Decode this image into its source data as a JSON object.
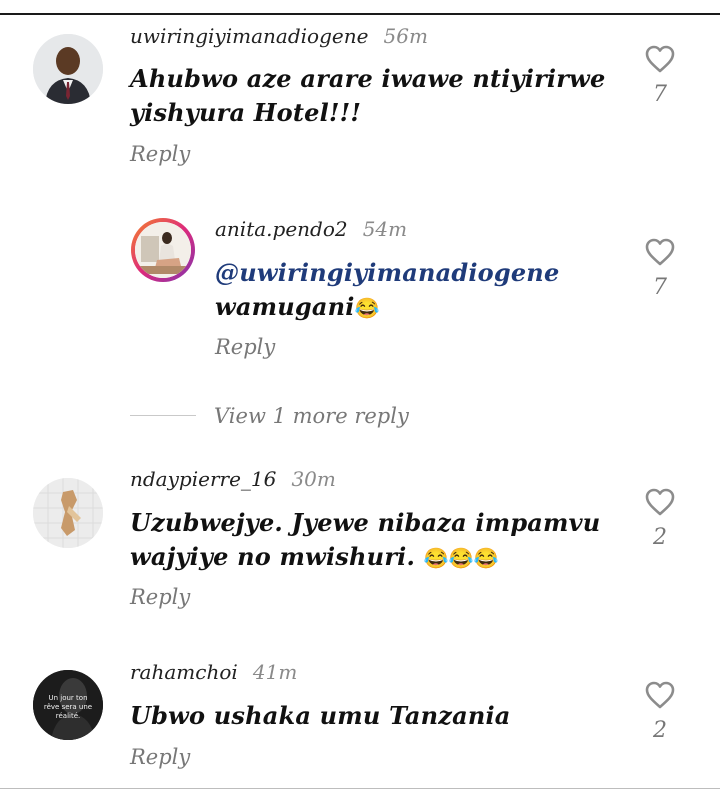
{
  "comments": [
    {
      "username": "uwiringiyimanadiogene",
      "time": "56m",
      "text_line1": "Ahubwo aze arare iwawe ntiyirirwe",
      "text_line2": "yishyura Hotel!!!",
      "reply_label": "Reply",
      "likes": "7"
    },
    {
      "username": "anita.pendo2",
      "time": "54m",
      "mention": "@uwiringiyimanadiogene",
      "text_line2": "wamugani",
      "emoji": "😂",
      "reply_label": "Reply",
      "likes": "7"
    },
    {
      "username": "ndaypierre_16",
      "time": "30m",
      "text_line1": "Uzubwejye. Jyewe nibaza impamvu",
      "text_line2": "wajyiye no mwishuri.",
      "emoji": "😂😂😂",
      "reply_label": "Reply",
      "likes": "2"
    },
    {
      "username": "rahamchoi",
      "time": "41m",
      "text_line1": "Ubwo ushaka umu Tanzania",
      "reply_label": "Reply",
      "likes": "2",
      "avatar_text": "Un jour ton rêve sera une réalité."
    }
  ],
  "view_more": "View 1 more reply",
  "colors": {
    "mention": "#1f3b7a",
    "emoji": "#d23ad6",
    "story_ring_start": "#f58529",
    "story_ring_end": "#dd2a7b"
  },
  "icons": {
    "like": "heart-outline-icon"
  }
}
